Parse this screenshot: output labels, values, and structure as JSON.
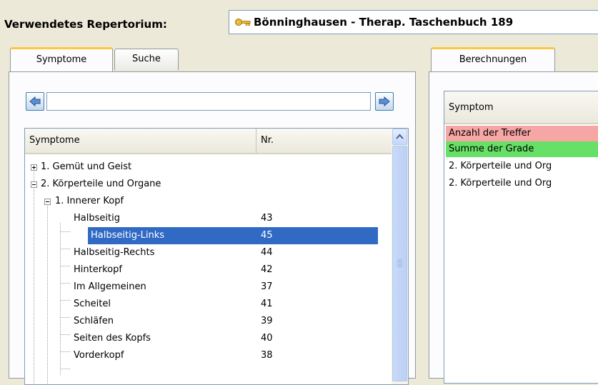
{
  "header": {
    "label": "Verwendetes Repertorium:",
    "repertory_value": "Bönninghausen - Therap. Taschenbuch 189"
  },
  "left_panel": {
    "tabs": [
      {
        "label": "Symptome"
      },
      {
        "label": "Suche"
      }
    ],
    "search_value": "",
    "columns": {
      "symptom": "Symptome",
      "nr": "Nr."
    },
    "tree": [
      {
        "label": "1. Gemüt und Geist",
        "nr": ""
      },
      {
        "label": "2. Körperteile und Organe",
        "nr": ""
      },
      {
        "label": "1. Innerer Kopf",
        "nr": ""
      },
      {
        "label": "Halbseitig",
        "nr": "43"
      },
      {
        "label": "Halbseitig-Links",
        "nr": "45"
      },
      {
        "label": "Halbseitig-Rechts",
        "nr": "44"
      },
      {
        "label": "Hinterkopf",
        "nr": "42"
      },
      {
        "label": "Im Allgemeinen",
        "nr": "37"
      },
      {
        "label": "Scheitel",
        "nr": "41"
      },
      {
        "label": "Schläfen",
        "nr": "39"
      },
      {
        "label": "Seiten des Kopfs",
        "nr": "40"
      },
      {
        "label": "Vorderkopf",
        "nr": "38"
      }
    ]
  },
  "right_panel": {
    "tabs": [
      {
        "label": "Berechnungen"
      }
    ],
    "column": "Symptom",
    "rows": [
      {
        "label": "Anzahl der Treffer",
        "color": "#f7a6a6"
      },
      {
        "label": "Summe der Grade",
        "color": "#66e066"
      },
      {
        "label": "2. Körperteile und Org"
      },
      {
        "label": "2. Körperteile und Org"
      }
    ]
  },
  "colors": {
    "selection": "#316ac5",
    "tab_accent": "#ffc83c"
  }
}
